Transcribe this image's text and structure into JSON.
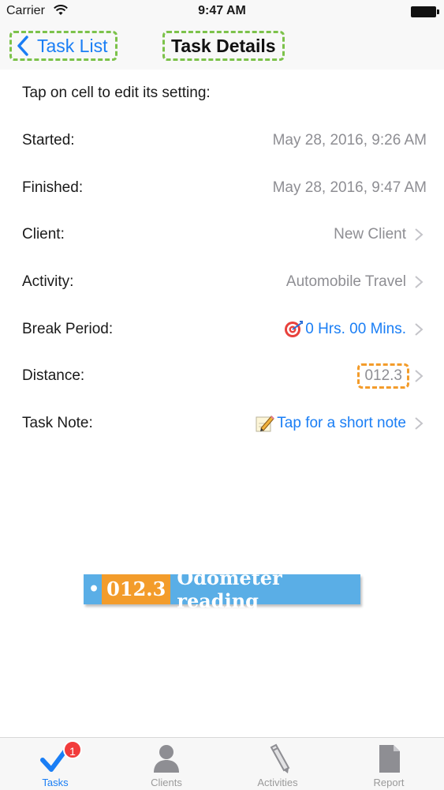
{
  "status_bar": {
    "carrier": "Carrier",
    "time": "9:47 AM"
  },
  "nav": {
    "back_label": "Task List",
    "title": "Task Details"
  },
  "intro": "Tap on cell to edit its setting:",
  "rows": [
    {
      "label": "Started:",
      "value": "May 28, 2016, 9:26 AM"
    },
    {
      "label": "Finished:",
      "value": "May 28, 2016, 9:47 AM"
    },
    {
      "label": "Client:",
      "value": "New Client"
    },
    {
      "label": "Activity:",
      "value": "Automobile Travel"
    },
    {
      "label": "Break Period:",
      "value": "0 Hrs. 00 Mins."
    },
    {
      "label": "Distance:",
      "value": "012.3"
    },
    {
      "label": "Task Note:",
      "value": "Tap for a short note"
    }
  ],
  "callout": {
    "bullet": "•",
    "number": "012.3",
    "text": "Odometer reading"
  },
  "tabs": [
    {
      "label": "Tasks",
      "badge": "1",
      "icon": "checkmark-icon"
    },
    {
      "label": "Clients",
      "icon": "person-icon"
    },
    {
      "label": "Activities",
      "icon": "pencil-icon"
    },
    {
      "label": "Report",
      "icon": "document-icon"
    }
  ],
  "colors": {
    "accent": "#1a7ef5",
    "highlight_green": "#7cc24a",
    "highlight_orange": "#f39c2b",
    "callout_blue": "#5aaee6",
    "badge_red": "#f23b3b"
  }
}
